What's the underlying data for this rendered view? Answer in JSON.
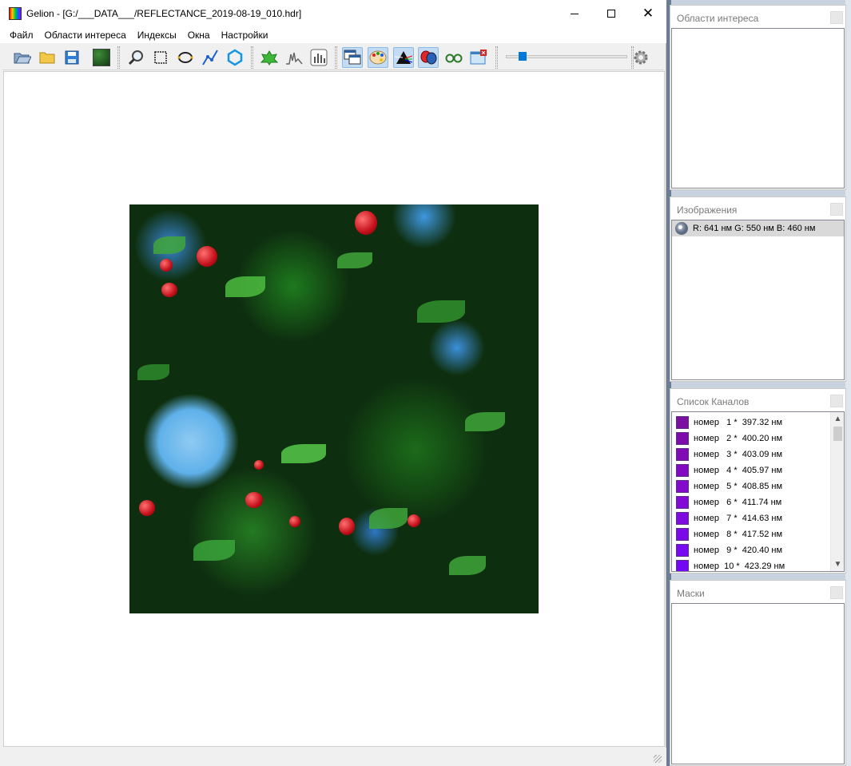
{
  "window": {
    "title": "Gelion - [G:/___DATA___/REFLECTANCE_2019-08-19_010.hdr]",
    "minimize": "–",
    "maximize": "□",
    "close": "✕"
  },
  "menu": [
    "Файл",
    "Области интереса",
    "Индексы",
    "Окна",
    "Настройки"
  ],
  "toolbar": {
    "icons": [
      "open-folder-icon",
      "folder-icon",
      "save-icon",
      "image-thumb-icon",
      "magnifier-icon",
      "rectangle-select-icon",
      "ellipse-select-icon",
      "polyline-icon",
      "polygon-icon",
      "leaf-icon",
      "histogram-icon",
      "bar-chart-icon",
      "windows-icon",
      "palette-icon",
      "prism-icon",
      "masks-icon",
      "glasses-icon",
      "close-image-icon",
      "gear-icon"
    ],
    "slider_value": 0.12
  },
  "panels": {
    "roi": {
      "title": "Области интереса"
    },
    "images": {
      "title": "Изображения",
      "items": [
        "R: 641 нм G: 550 нм B: 460 нм"
      ]
    },
    "channels": {
      "title": "Список Каналов",
      "items": [
        {
          "text": "номер   1 *  397.32 нм",
          "color": "#7a0fa0"
        },
        {
          "text": "номер   2 *  400.20 нм",
          "color": "#7d0daa"
        },
        {
          "text": "номер   3 *  403.09 нм",
          "color": "#800cb5"
        },
        {
          "text": "номер   4 *  405.97 нм",
          "color": "#820bc2"
        },
        {
          "text": "номер   5 *  408.85 нм",
          "color": "#830bcc"
        },
        {
          "text": "номер   6 *  411.74 нм",
          "color": "#820bd6"
        },
        {
          "text": "номер   7 *  414.63 нм",
          "color": "#800be0"
        },
        {
          "text": "номер   8 *  417.52 нм",
          "color": "#7c0ae8"
        },
        {
          "text": "номер   9 *  420.40 нм",
          "color": "#770af0"
        },
        {
          "text": "номер  10 *  423.29 нм",
          "color": "#7209f5"
        }
      ]
    },
    "masks": {
      "title": "Маски"
    }
  }
}
